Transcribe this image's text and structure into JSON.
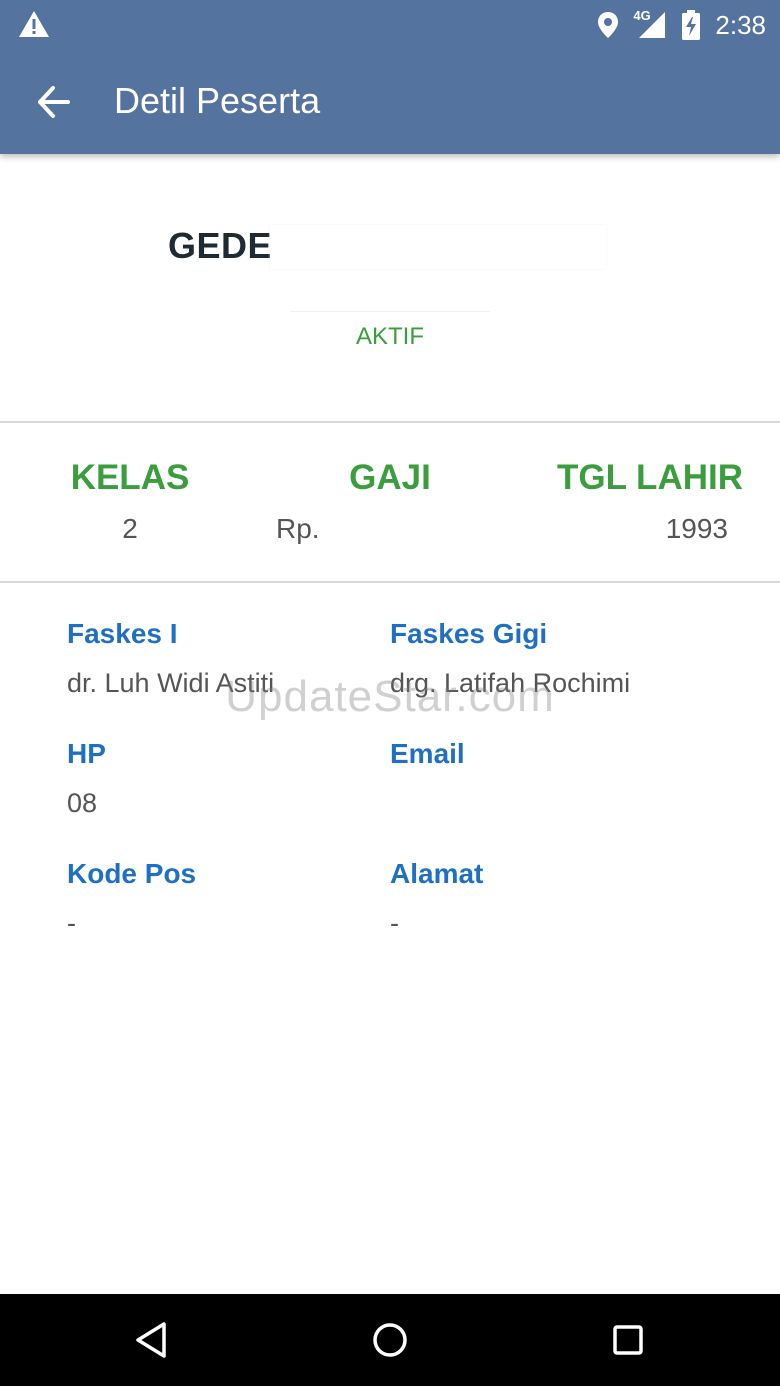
{
  "status_bar": {
    "time": "2:38",
    "network": "4G",
    "icons": [
      "warning-icon",
      "location-icon",
      "signal-icon",
      "battery-charging-icon"
    ]
  },
  "app_bar": {
    "title": "Detil Peserta",
    "back_icon": "arrow-back-icon"
  },
  "participant": {
    "name": "GEDE",
    "status": "AKTIF"
  },
  "stats": {
    "kelas": {
      "label": "KELAS",
      "value": "2"
    },
    "gaji": {
      "label": "GAJI",
      "value": "Rp."
    },
    "tgl_lahir": {
      "label": "TGL LAHIR",
      "value": "1993"
    }
  },
  "details": {
    "faskes1": {
      "label": "Faskes I",
      "value": "dr. Luh Widi Astiti"
    },
    "faskes_gigi": {
      "label": "Faskes Gigi",
      "value": "drg. Latifah Rochimi"
    },
    "hp": {
      "label": "HP",
      "value": "08"
    },
    "email": {
      "label": "Email",
      "value": ""
    },
    "kode_pos": {
      "label": "Kode Pos",
      "value": "-"
    },
    "alamat": {
      "label": "Alamat",
      "value": "-"
    }
  },
  "watermark": "UpdateStar.com",
  "colors": {
    "app_bar": "#54739f",
    "green": "#3a9d3e",
    "blue": "#1f6fc5"
  }
}
